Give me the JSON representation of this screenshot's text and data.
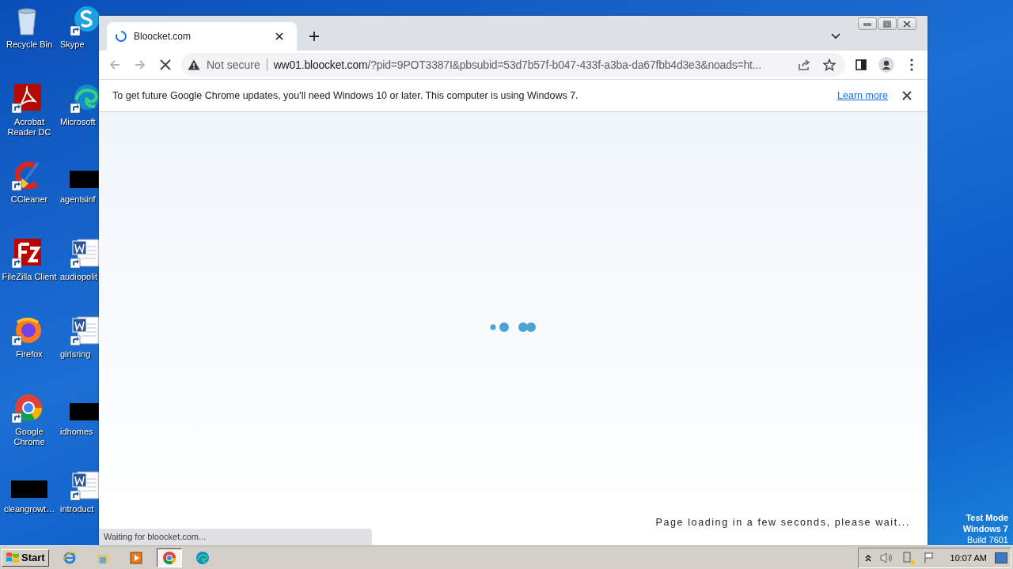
{
  "desktop": {
    "icons": [
      {
        "label": "Recycle Bin",
        "kind": "recycle"
      },
      {
        "label": "Skype",
        "kind": "skype"
      },
      {
        "label": "Acrobat Reader DC",
        "kind": "acrobat"
      },
      {
        "label": "Microsoft",
        "kind": "edge"
      },
      {
        "label": "CCleaner",
        "kind": "ccleaner"
      },
      {
        "label": "agentsinf",
        "kind": "redacted"
      },
      {
        "label": "FileZilla Client",
        "kind": "filezilla"
      },
      {
        "label": "audiopolit",
        "kind": "word"
      },
      {
        "label": "Firefox",
        "kind": "firefox"
      },
      {
        "label": "girlsring",
        "kind": "word"
      },
      {
        "label": "Google Chrome",
        "kind": "chrome"
      },
      {
        "label": "idhomes",
        "kind": "redacted"
      },
      {
        "label": "cleangrowt…",
        "kind": "redacted"
      },
      {
        "label": "introduct",
        "kind": "word"
      }
    ],
    "system_notice": [
      "Test Mode",
      "Windows 7",
      "Build 7601"
    ]
  },
  "browser": {
    "tab": {
      "title": "Bloocket.com",
      "loading": true
    },
    "toolbar": {
      "security_label": "Not secure",
      "url_host": "ww01.bloocket.com",
      "url_rest": "/?pid=9POT3387I&pbsubid=53d7b57f-b047-433f-a3ba-da67fbb4d3e3&noads=ht..."
    },
    "infobar": {
      "message": "To get future Google Chrome updates, you'll need Windows 10 or later. This computer is using Windows 7.",
      "link": "Learn more"
    },
    "content": {
      "message": "Page loading in a few seconds, please wait..."
    },
    "status_bubble": "Waiting for bloocket.com..."
  },
  "taskbar": {
    "start_label": "Start",
    "apps": [
      {
        "kind": "ie",
        "selected": false
      },
      {
        "kind": "explorer",
        "selected": false
      },
      {
        "kind": "media",
        "selected": false
      },
      {
        "kind": "chrome",
        "selected": true
      },
      {
        "kind": "edge",
        "selected": false
      }
    ],
    "clock": "10:07 AM"
  }
}
